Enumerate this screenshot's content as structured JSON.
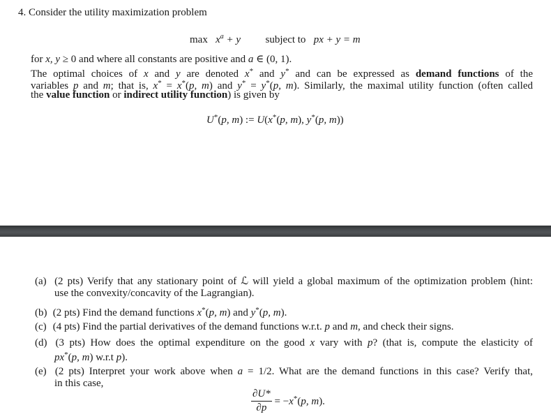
{
  "problem": {
    "number": "4.",
    "intro": "Consider the utility maximization problem",
    "objective": {
      "op": "max",
      "expr": "x^a + y",
      "constraint_label": "subject to",
      "constraint": "px + y = m"
    },
    "paragraph": {
      "line1": "for x, y ≥ 0 and where all constants are positive and a ∈ (0, 1).",
      "line2": "The optimal choices of x and y are denoted x* and y* and can be expressed as demand functions of the",
      "line3": "variables p and m; that is, x* = x*(p, m) and y* = y*(p, m). Similarly, the maximal utility function (often called",
      "line4": "the value function or indirect utility function) is given by",
      "bold_terms": [
        "demand functions",
        "value function",
        "indirect utility function"
      ]
    },
    "value_function_eq": "U*(p, m) := U(x*(p, m), y*(p, m))"
  },
  "parts": [
    {
      "label": "(a)",
      "points": "(2 pts)",
      "text_line1": "Verify that any stationary point of ℒ will yield a global maximum of the optimization problem (hint:",
      "text_line2": "use the convexity/concavity of the Lagrangian)."
    },
    {
      "label": "(b)",
      "points": "(2 pts)",
      "text_line1": "Find the demand functions x*(p, m) and y*(p, m)."
    },
    {
      "label": "(c)",
      "points": "(4 pts)",
      "text_line1": "Find the partial derivatives of the demand functions w.r.t. p and m, and check their signs."
    },
    {
      "label": "(d)",
      "points": "(3 pts)",
      "text_line1": "How does the optimal expenditure on the good x vary with p? (that is, compute the elasticity of",
      "text_line2": "px*(p, m) w.r.t p)."
    },
    {
      "label": "(e)",
      "points": "(2 pts)",
      "text_line1": "Interpret your work above when a = 1/2. What are the demand functions in this case? Verify that,",
      "text_line2": "in this case,",
      "equation": {
        "numerator": "∂U*",
        "denominator": "∂p",
        "rhs": "= −x*(p, m)."
      }
    }
  ],
  "divider": {
    "color_top": "#2f3234",
    "color_mid": "#505457"
  }
}
